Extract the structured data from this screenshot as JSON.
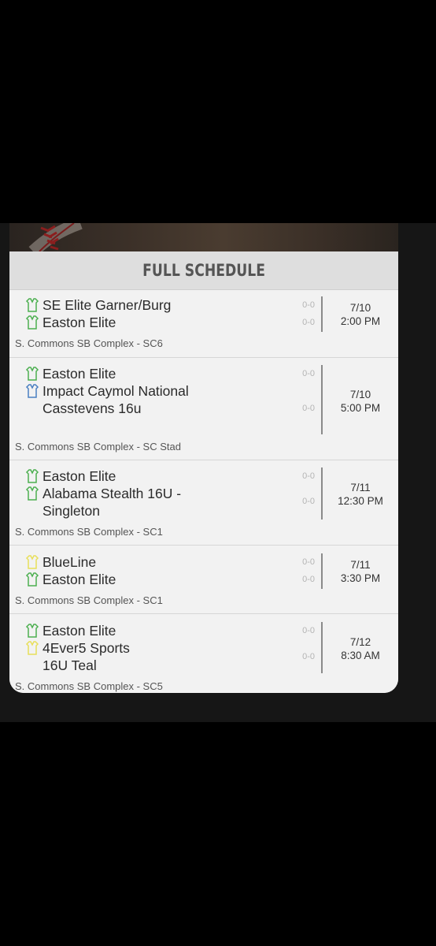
{
  "header": {
    "title": "FULL SCHEDULE"
  },
  "colors": {
    "green": "#4caf50",
    "blue": "#4a7fc1",
    "yellow": "#e8df5a"
  },
  "games": [
    {
      "home": {
        "name": "SE Elite Garner/Burg",
        "icon": "green-jersey-icon",
        "score": "0-0"
      },
      "away": {
        "name": "Easton Elite",
        "icon": "green-jersey-icon",
        "score": "0-0"
      },
      "date": "7/10",
      "time": "2:00 PM",
      "venue": "S. Commons SB Complex - SC6"
    },
    {
      "home": {
        "name": "Easton Elite",
        "icon": "green-jersey-icon",
        "score": "0-0"
      },
      "away": {
        "name": "Impact Caymol National Casstevens 16u",
        "icon": "blue-jersey-icon",
        "score": "0-0"
      },
      "date": "7/10",
      "time": "5:00 PM",
      "venue": "S. Commons SB Complex - SC Stad"
    },
    {
      "home": {
        "name": "Easton Elite",
        "icon": "green-jersey-icon",
        "score": "0-0"
      },
      "away": {
        "name": "Alabama Stealth 16U - Singleton",
        "icon": "green-jersey-icon",
        "score": "0-0"
      },
      "date": "7/11",
      "time": "12:30 PM",
      "venue": "S. Commons SB Complex - SC1"
    },
    {
      "home": {
        "name": "BlueLine",
        "icon": "yellow-jersey-icon",
        "score": "0-0"
      },
      "away": {
        "name": "Easton Elite",
        "icon": "green-jersey-icon",
        "score": "0-0"
      },
      "date": "7/11",
      "time": "3:30 PM",
      "venue": "S. Commons SB Complex - SC1"
    },
    {
      "home": {
        "name": "Easton Elite",
        "icon": "green-jersey-icon",
        "score": "0-0"
      },
      "away": {
        "name": "4Ever5 Sports 16U Teal",
        "icon": "yellow-jersey-icon",
        "score": "0-0"
      },
      "date": "7/12",
      "time": "8:30 AM",
      "venue": "S. Commons SB Complex - SC5"
    }
  ]
}
